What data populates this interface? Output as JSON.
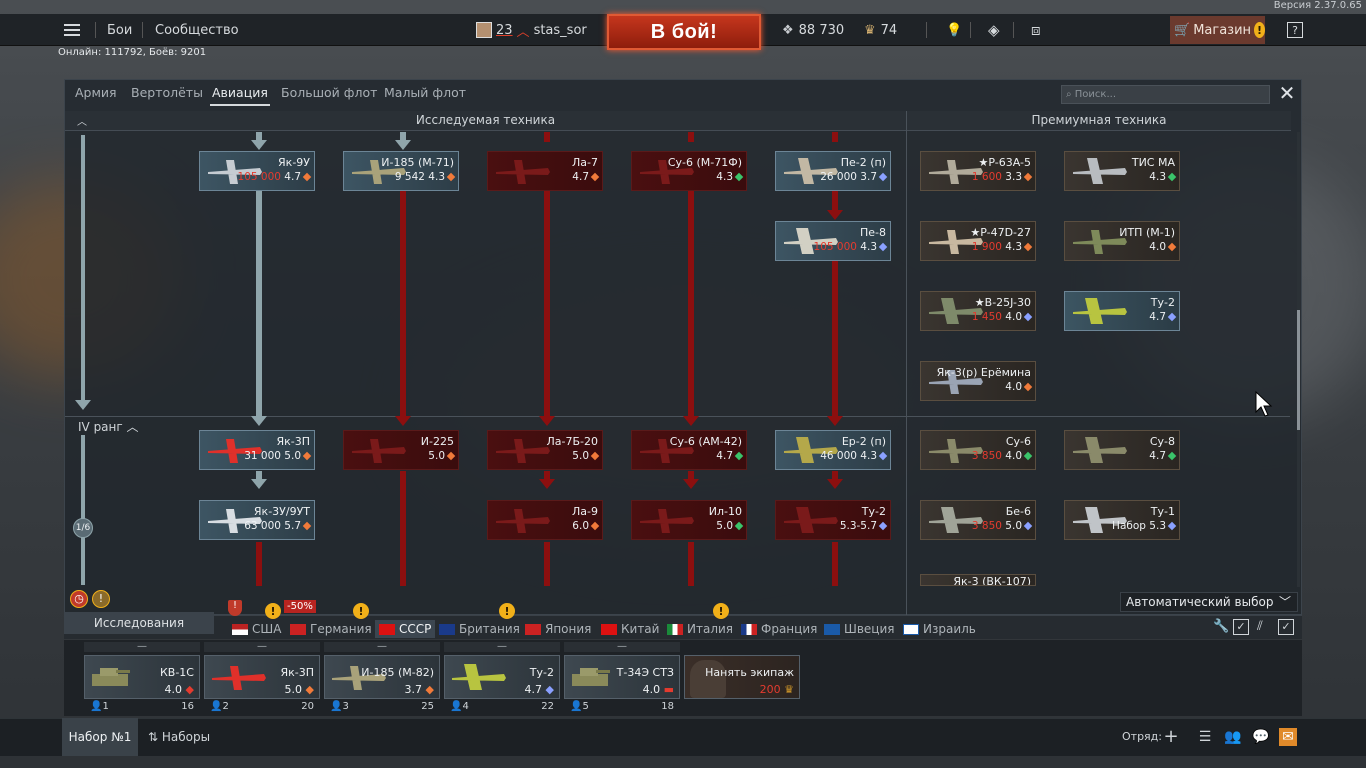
{
  "version": "Версия 2.37.0.65",
  "topbar": {
    "menu_icon": "hamburger-icon",
    "battles": "Бои",
    "community": "Сообщество",
    "player_level": "23",
    "player_name": "stas_sor",
    "battle_button": "В бой!",
    "silver_lions": "88 730",
    "eagles": "74",
    "shop": "Магазин",
    "help": "?"
  },
  "online": "Онлайн: 111792, Боёв: 9201",
  "tabs": [
    "Армия",
    "Вертолёты",
    "Авиация",
    "Большой флот",
    "Малый флот"
  ],
  "active_tab": "Авиация",
  "search_placeholder": "Поиск...",
  "columns": {
    "researched": "Исследуемая техника",
    "premium": "Премиумная техника"
  },
  "rank_label": "IV ранг",
  "rank_progress": "1/6",
  "tree_cards": [
    {
      "id": "yak9u",
      "name": "Як-9У",
      "cost": "105 000",
      "br": "4.7",
      "state": "researched"
    },
    {
      "id": "i185m71",
      "name": "И-185 (М-71)",
      "cost": "9 542",
      "br": "4.3",
      "state": "researched"
    },
    {
      "id": "la7",
      "name": "Ла-7",
      "cost": "",
      "br": "4.7",
      "state": "locked"
    },
    {
      "id": "su6m71f",
      "name": "Су-6 (М-71Ф)",
      "cost": "",
      "br": "4.3",
      "state": "locked"
    },
    {
      "id": "pe2p",
      "name": "Пе-2 (п)",
      "cost": "26 000",
      "br": "3.7",
      "state": "researched"
    },
    {
      "id": "pe8",
      "name": "Пе-8",
      "cost": "105 000",
      "br": "4.3",
      "state": "researched"
    },
    {
      "id": "yak3p",
      "name": "Як-3П",
      "cost": "31 000",
      "br": "5.0",
      "state": "researched"
    },
    {
      "id": "i225",
      "name": "И-225",
      "cost": "",
      "br": "5.0",
      "state": "locked"
    },
    {
      "id": "la7b20",
      "name": "Ла-7Б-20",
      "cost": "",
      "br": "5.0",
      "state": "locked"
    },
    {
      "id": "su6am42",
      "name": "Су-6 (АМ-42)",
      "cost": "",
      "br": "4.7",
      "state": "locked"
    },
    {
      "id": "er2p",
      "name": "Ер-2 (п)",
      "cost": "46 000",
      "br": "4.3",
      "state": "researched"
    },
    {
      "id": "yak3u9ut",
      "name": "Як-3У/9УТ",
      "cost": "63 000",
      "br": "5.7",
      "state": "researched"
    },
    {
      "id": "la9",
      "name": "Ла-9",
      "cost": "",
      "br": "6.0",
      "state": "locked"
    },
    {
      "id": "il10",
      "name": "Ил-10",
      "cost": "",
      "br": "5.0",
      "state": "locked"
    },
    {
      "id": "tu2",
      "name": "Ту-2",
      "cost": "",
      "br": "5.3-5.7",
      "state": "locked"
    }
  ],
  "premium_cards": [
    {
      "id": "p63a5",
      "name": "★P-63A-5",
      "cost": "1 600",
      "br": "3.3"
    },
    {
      "id": "tisma",
      "name": "ТИС МА",
      "cost": "",
      "br": "4.3"
    },
    {
      "id": "p47d27",
      "name": "★P-47D-27",
      "cost": "1 900",
      "br": "4.3"
    },
    {
      "id": "itpm1",
      "name": "ИТП (М-1)",
      "cost": "",
      "br": "4.0"
    },
    {
      "id": "b25j30",
      "name": "★B-25J-30",
      "cost": "1 450",
      "br": "4.0"
    },
    {
      "id": "tu2prem",
      "name": "Ту-2",
      "cost": "",
      "br": "4.7"
    },
    {
      "id": "yak3r",
      "name": "Як-3(р) Ерёмина",
      "cost": "",
      "br": "4.0"
    },
    {
      "id": "su6",
      "name": "Су-6",
      "cost": "3 850",
      "br": "4.0"
    },
    {
      "id": "su8",
      "name": "Су-8",
      "cost": "",
      "br": "4.7"
    },
    {
      "id": "be6",
      "name": "Бе-6",
      "cost": "3 850",
      "br": "5.0"
    },
    {
      "id": "tu1",
      "name": "Ту-1",
      "cost": "Набор",
      "br": "5.3"
    },
    {
      "id": "yak3vk107",
      "name": "Як-3 (ВК-107)",
      "cost": "",
      "br": ""
    }
  ],
  "auto_select": "Автоматический выбор",
  "research_tab": "Исследования",
  "discount": "-50%",
  "nations": [
    "США",
    "Германия",
    "СССР",
    "Британия",
    "Япония",
    "Китай",
    "Италия",
    "Франция",
    "Швеция",
    "Израиль"
  ],
  "active_nation": "СССР",
  "slots": [
    {
      "name": "КВ-1С",
      "br": "4.0",
      "num": "1",
      "crew": "16"
    },
    {
      "name": "Як-3П",
      "br": "5.0",
      "num": "2",
      "crew": "20"
    },
    {
      "name": "И-185 (М-82)",
      "br": "3.7",
      "num": "3",
      "crew": "25"
    },
    {
      "name": "Ту-2",
      "br": "4.7",
      "num": "4",
      "crew": "22"
    },
    {
      "name": "Т-34Э СТЗ",
      "br": "4.0",
      "num": "5",
      "crew": "18"
    }
  ],
  "hire_crew": {
    "label": "Нанять экипаж",
    "cost": "200"
  },
  "footer": {
    "preset_active": "Набор №1",
    "presets": "Наборы",
    "squad": "Отряд:"
  }
}
